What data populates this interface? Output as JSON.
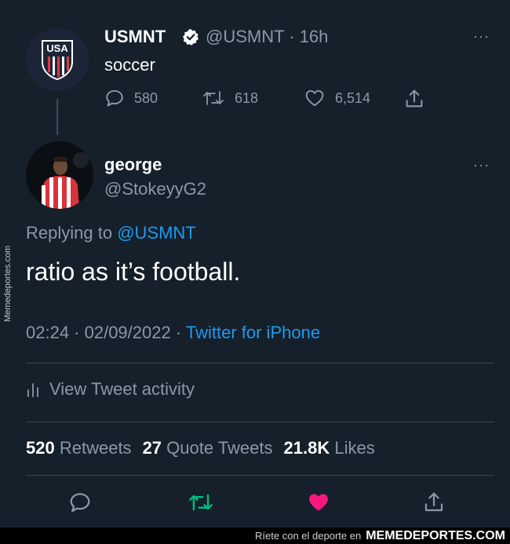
{
  "parent_tweet": {
    "name": "USMNT",
    "handle_time": "@USMNT · 16h",
    "text": "soccer",
    "replies": "580",
    "retweets": "618",
    "likes": "6,514",
    "more": "···",
    "avatar_logo_text": "USA"
  },
  "reply_tweet": {
    "name": "george",
    "handle": "@StokeyyG2",
    "replying_prefix": "Replying to",
    "replying_to": "@USMNT",
    "text": "ratio as it’s football.",
    "timestamp": "02:24 · 02/09/2022 ·",
    "source": "Twitter for iPhone",
    "more": "···"
  },
  "activity": {
    "label": "View Tweet activity"
  },
  "stats": {
    "retweets_count": "520",
    "retweets_label": "Retweets",
    "quote_count": "27",
    "quote_label": "Quote Tweets",
    "likes_count": "21.8K",
    "likes_label": "Likes"
  },
  "watermark": {
    "side": "Memedeportes.com",
    "footer_prefix": "Ríete con el deporte en",
    "footer_brand": "MEMEDEPORTES.COM"
  },
  "colors": {
    "background": "#15202b",
    "accent": "#1d9bf0",
    "retweet_green": "#00ba7c",
    "like_pink": "#f91880",
    "muted": "#8b98a5"
  }
}
